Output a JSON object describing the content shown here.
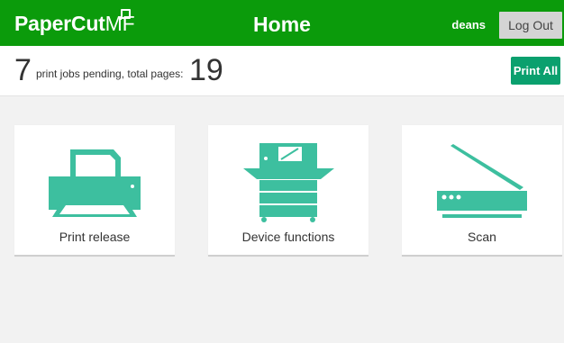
{
  "header": {
    "logo_main": "PaperCut",
    "logo_suffix": "MF",
    "title": "Home",
    "username": "deans",
    "logout_label": "Log Out"
  },
  "status": {
    "jobs_pending": "7",
    "text": "print jobs pending, total pages:",
    "total_pages": "19",
    "print_all_label": "Print All"
  },
  "cards": [
    {
      "label": "Print release",
      "icon": "printer-icon"
    },
    {
      "label": "Device functions",
      "icon": "copier-icon"
    },
    {
      "label": "Scan",
      "icon": "scanner-icon"
    }
  ],
  "colors": {
    "header_bg": "#0b9b0b",
    "accent": "#3dbf9f",
    "print_all_bg": "#0aa06e"
  }
}
